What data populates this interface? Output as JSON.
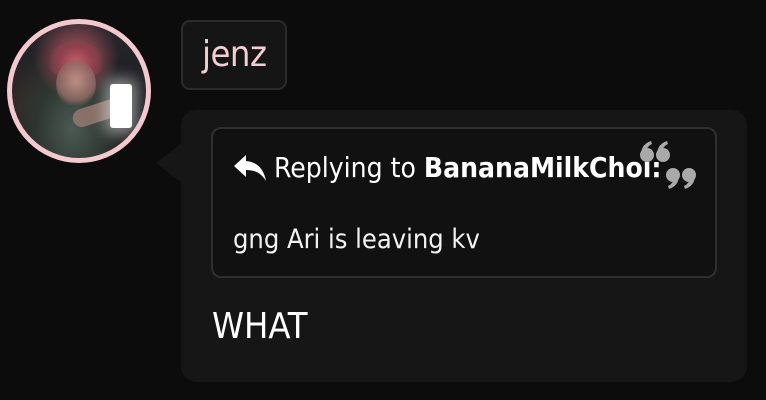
{
  "message": {
    "username": "jenz",
    "avatar": {
      "icon": "user-avatar-photo",
      "border_color": "#f3c9cf"
    },
    "reply": {
      "icon": "reply-arrow-icon",
      "label": "Replying to",
      "author": "BananaMilkChoi:",
      "quote_icon": "quote-mark-icon",
      "quoted_text": "gng Ari is leaving kv"
    },
    "body": "WHAT"
  },
  "colors": {
    "background": "#0c0c0c",
    "bubble": "#161616",
    "username_text": "#f4ced4",
    "quote_icon": "#a9a9a9"
  }
}
